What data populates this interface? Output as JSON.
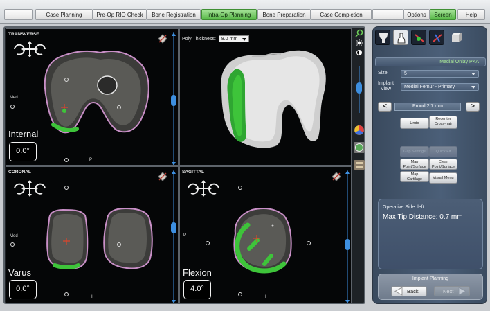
{
  "tabs": [
    {
      "label": "",
      "active": false
    },
    {
      "label": "Case Planning",
      "active": false
    },
    {
      "label": "Pre-Op RIO Check",
      "active": false
    },
    {
      "label": "Bone Registration",
      "active": false
    },
    {
      "label": "Intra-Op Planning",
      "active": true
    },
    {
      "label": "Bone Preparation",
      "active": false
    },
    {
      "label": "Case Completion",
      "active": false
    },
    {
      "label": "",
      "active": false
    },
    {
      "label": "Options",
      "active": false
    },
    {
      "label": "Screen",
      "active": true
    },
    {
      "label": "Help",
      "active": false
    }
  ],
  "views": {
    "transverse": {
      "label": "TRANSVERSE",
      "side": "Med",
      "marker": "P",
      "angle_label": "Internal",
      "angle_value": "0.0°"
    },
    "coronal": {
      "label": "CORONAL",
      "side": "Med",
      "marker": "I",
      "angle_label": "Varus",
      "angle_value": "0.0°"
    },
    "sagittal": {
      "label": "SAGITTAL",
      "side": "P",
      "marker": "I",
      "angle_label": "Flexion",
      "angle_value": "4.0°"
    },
    "model3d": {
      "poly_label": "Poly Thickness:",
      "poly_value": "8.0 mm"
    }
  },
  "panel": {
    "header": "Medial Onlay PKA",
    "size_label": "Size",
    "size_value": "5",
    "implant_view_label_1": "Implant",
    "implant_view_label_2": "View",
    "implant_view_value": "Medial Femur - Primary",
    "proud_value": "Proud 2.7 mm",
    "minus_label": "<",
    "plus_label": ">",
    "buttons": {
      "undo": "Undo",
      "recenter_1": "Recenter",
      "recenter_2": "Cross-hair",
      "gap_settings": "Gap Settings",
      "quick_fit": "Quick Fit",
      "map_point_1": "Map",
      "map_point_2": "Point/Surface",
      "clear_point_1": "Clear",
      "clear_point_2": "Point/Surface",
      "map_cartilage_1": "Map",
      "map_cartilage_2": "Cartilage",
      "visual_menu": "Visual Menu"
    },
    "info": {
      "operative_side": "Operative Side: left",
      "max_tip": "Max Tip Distance: 0.7 mm"
    },
    "footer": {
      "title": "Implant Planning",
      "back": "Back",
      "next": "Next"
    }
  },
  "colors": {
    "implant_green": "#3ec43a",
    "bone_outline": "#c98fc7",
    "active_tab": "#6cc75a",
    "panel_bg": "#4b5f78",
    "scroll_blue": "#3d8fe0"
  },
  "icons": [
    "pan-arrows-icon",
    "rotate-left-icon",
    "rotate-right-icon",
    "maximize-icon",
    "zoom-icon",
    "brightness-icon",
    "contrast-icon",
    "femur-icon",
    "tibia-icon",
    "implant-icon"
  ]
}
